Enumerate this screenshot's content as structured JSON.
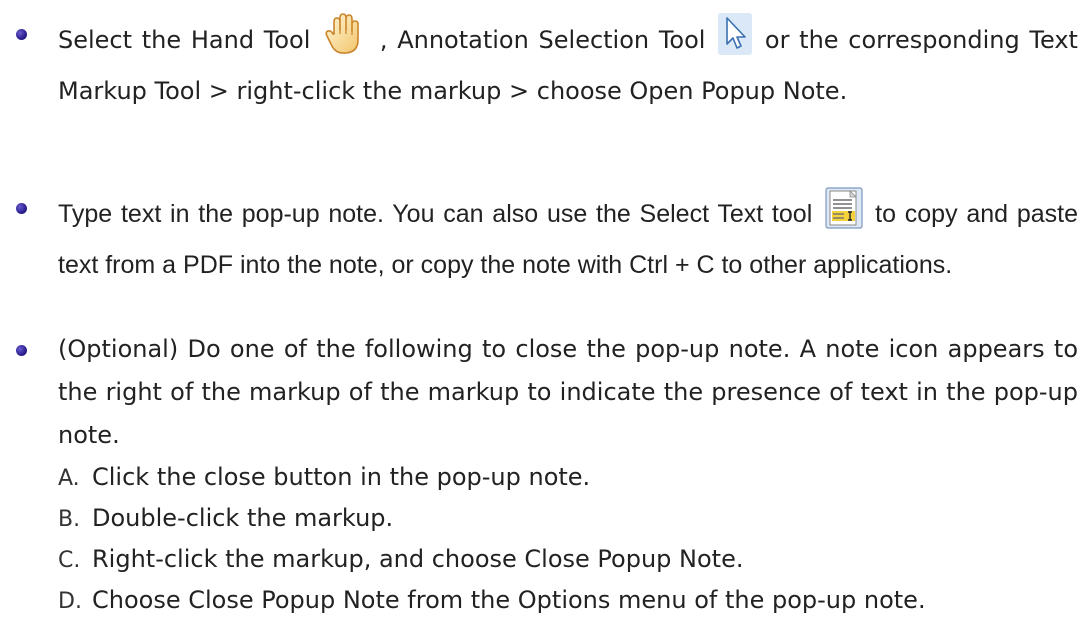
{
  "bullets": [
    {
      "text_before_hand": "Select the Hand Tool",
      "hand_icon": "hand-tool-icon",
      "text_between": ", Annotation Selection Tool",
      "selection_icon": "annotation-selection-tool-icon",
      "text_after": "or the corresponding Text Markup Tool > right-click the markup > choose Open Popup Note."
    },
    {
      "text_before_icon": "Type text in the pop-up note. You can also use the Select Text tool",
      "select_text_icon": "select-text-tool-icon",
      "text_after_icon": "to copy and paste text from a PDF into the note, or copy the note with Ctrl + C to other applications."
    },
    {
      "text": "(Optional) Do one of the following to close the pop-up note. A note icon appears to the right of the markup of the markup to indicate the presence of text in the pop-up note."
    }
  ],
  "sub_items": [
    {
      "letter": "A.",
      "text": "Click the close button in the pop-up note."
    },
    {
      "letter": "B.",
      "text": "Double-click the markup."
    },
    {
      "letter": "C.",
      "text": "Right-click the markup, and choose Close Popup Note."
    },
    {
      "letter": "D.",
      "text": "Choose Close Popup Note from the Options menu of the pop-up note."
    }
  ],
  "colors": {
    "bullet": "#2a1f8f",
    "text": "#222222"
  }
}
